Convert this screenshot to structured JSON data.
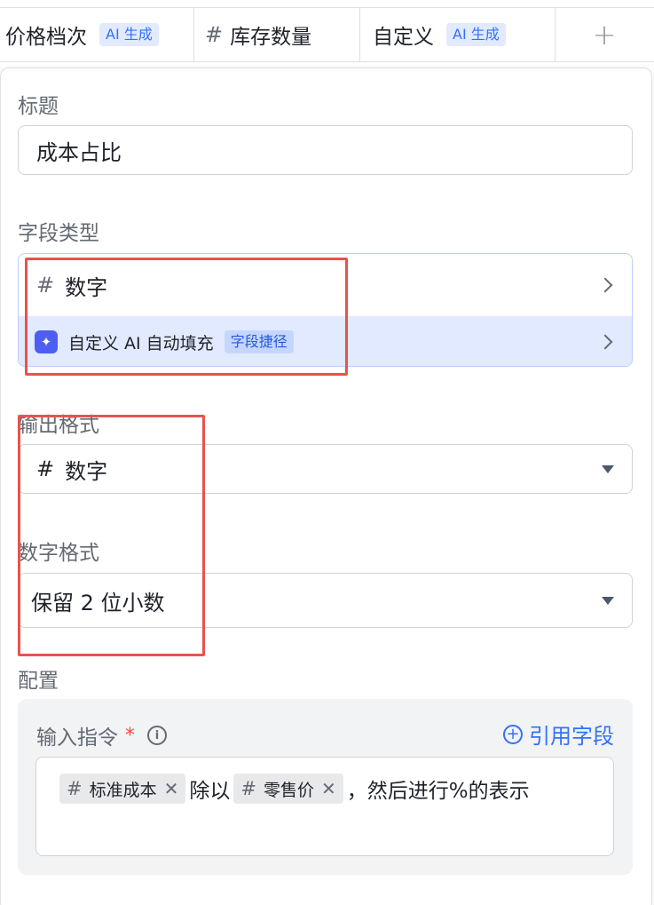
{
  "header_columns": [
    {
      "label": "价格档次",
      "tag": "AI 生成"
    },
    {
      "label": "库存数量",
      "icon": "hash-icon"
    },
    {
      "label": "自定义",
      "tag": "AI 生成"
    }
  ],
  "panel": {
    "title_label": "标题",
    "title_value": "成本占比",
    "field_type_label": "字段类型",
    "field_type": {
      "icon_glyph": "#",
      "value": "数字",
      "ai_option": "自定义 AI 自动填充",
      "ai_option_tag": "字段捷径"
    },
    "output_format_label": "输出格式",
    "output_format": {
      "icon_glyph": "#",
      "value": "数字"
    },
    "number_format_label": "数字格式",
    "number_format_value": "保留 2 位小数",
    "config_label": "配置",
    "instruction": {
      "label": "输入指令",
      "required_mark": "*",
      "info_glyph": "i",
      "reference_button": "引用字段",
      "chips": [
        {
          "label": "标准成本"
        },
        {
          "label": "零售价"
        }
      ],
      "text_between": "除以",
      "text_after": "，然后进行%的表示"
    }
  },
  "colors": {
    "accent": "#3370ff",
    "highlight_box": "#e9534d",
    "ai_row_bg": "#e1eaff"
  }
}
